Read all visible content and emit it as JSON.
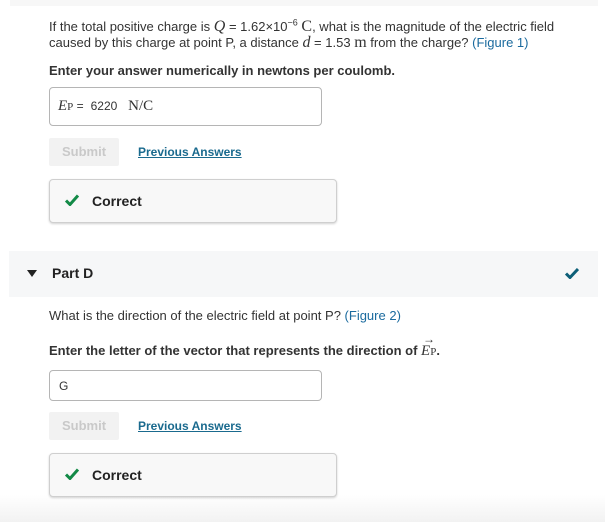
{
  "partC": {
    "question": {
      "pre": "If the total positive charge is ",
      "charge_symbol": "Q",
      "eq1": " = ",
      "charge_mantissa": "1.62×10",
      "charge_exponent": "−6",
      "charge_unit": "C",
      "mid": ", what is the magnitude of the electric field caused by this charge at point P, a distance ",
      "distance_symbol": "d",
      "eq2": " = ",
      "distance_value": "1.53 ",
      "distance_unit": "m",
      "post": " from the charge? ",
      "figure_link": "(Figure 1)"
    },
    "instruction": "Enter your answer numerically in newtons per coulomb.",
    "answer": {
      "symbol": "E",
      "subscript": "P",
      "equals": " = ",
      "value": "6220",
      "unit": "N/C"
    },
    "submit_label": "Submit",
    "previous_answers_label": "Previous Answers",
    "feedback": "Correct"
  },
  "partD": {
    "title": "Part D",
    "question": "What is the direction of the electric field at point P? ",
    "figure_link": "(Figure 2)",
    "instruction_pre": "Enter the letter of the vector that represents the direction of ",
    "instruction_symbol": "E",
    "instruction_subscript": "P",
    "instruction_post": ".",
    "answer_value": "G",
    "submit_label": "Submit",
    "previous_answers_label": "Previous Answers",
    "feedback": "Correct"
  },
  "colors": {
    "link": "#1a6a9e",
    "correct_green": "#138a47",
    "part_check": "#0d5f78"
  }
}
